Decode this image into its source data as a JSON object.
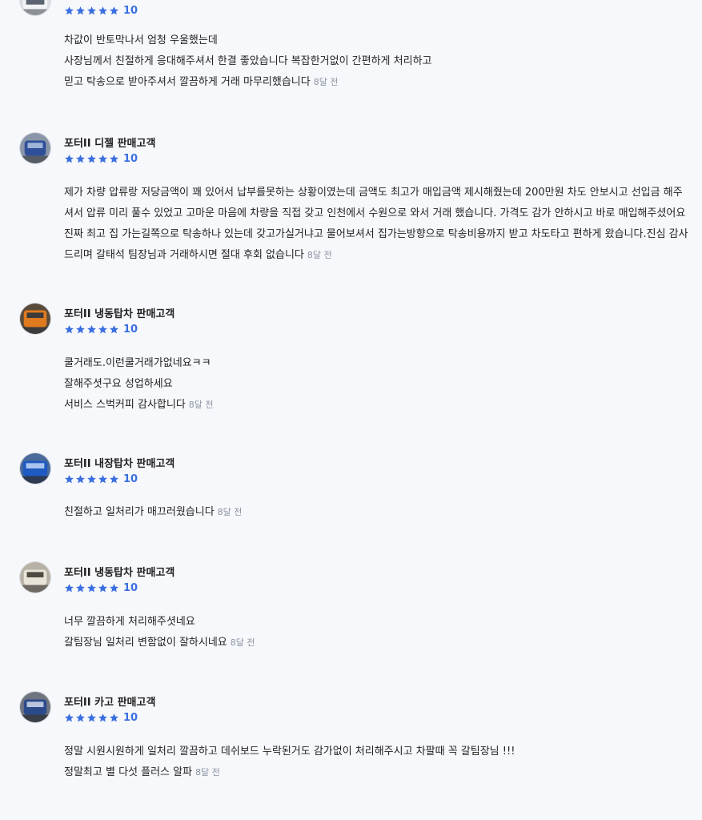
{
  "colors": {
    "star": "#3b6fe0",
    "score": "#3b6fe0",
    "time": "#8a93a3"
  },
  "reviews": [
    {
      "name": "",
      "score": "10",
      "lines": [
        "차값이 반토막나서 엄청 우울했는데",
        "사장님께서 친절하게 응대해주셔서 한결 좋았습니다 복잡한거없이 간편하게 처리하고",
        "믿고 탁송으로 받아주셔서 깔끔하게 거래 마무리했습니다"
      ],
      "time": "8달 전",
      "avatar": "truck-photo-white"
    },
    {
      "name": "포터II 디젤 판매고객",
      "score": "10",
      "lines": [
        "제가 차량 압류랑 저당금액이 꽤 있어서 납부를못하는 상황이였는데 금액도 최고가 매입금액 제시해줬는데 200만원 차도 안보시고 선입금 해주셔서 압류 미리 풀수 있었고 고마운 마음에 차량을 직접 갖고 인천에서 수원으로 와서 거래 했습니다. 가격도 감가 안하시고 바로 매입해주셨어요 진짜 최고 집 가는길쪽으로 탁송하나 있는데 갖고가실거냐고 물어보셔서 집가는방향으로 탁송비용까지 받고 차도타고 편하게 왔습니다.진심 감사드리며 갈태석 팀장님과 거래하시면 절대 후회 없습니다"
      ],
      "time": "8달 전",
      "avatar": "truck-photo-blue"
    },
    {
      "name": "포터II 냉동탑차 판매고객",
      "score": "10",
      "lines": [
        "쿨거래도.이런쿨거래가없네요ㅋㅋ",
        "잘해주셧구요 성업하세요",
        "서비스 스벅커피 감사합니다"
      ],
      "time": "8달 전",
      "avatar": "truck-photo-orange"
    },
    {
      "name": "포터II 내장탑차 판매고객",
      "score": "10",
      "lines": [
        "친절하고  일처리가 매끄러웠습니다"
      ],
      "time": "8달 전",
      "avatar": "truck-photo-blue"
    },
    {
      "name": "포터II 냉동탑차 판매고객",
      "score": "10",
      "lines": [
        "너무  깔끔하게  처리해주셧네요",
        "갈팀장님  일처리  변함없이  잘하시네요"
      ],
      "time": "8달 전",
      "avatar": "truck-photo-beige"
    },
    {
      "name": "포터II 카고 판매고객",
      "score": "10",
      "lines": [
        "정말 시원시원하게  일처리  깔끔하고 데쉬보드 누락된거도 감가없이 처리해주시고  차팔때 꼭 갈팀장님  !!!",
        "정말최고 별 다섯 플러스 알파"
      ],
      "time": "8달 전",
      "avatar": "truck-photo-navy"
    }
  ]
}
